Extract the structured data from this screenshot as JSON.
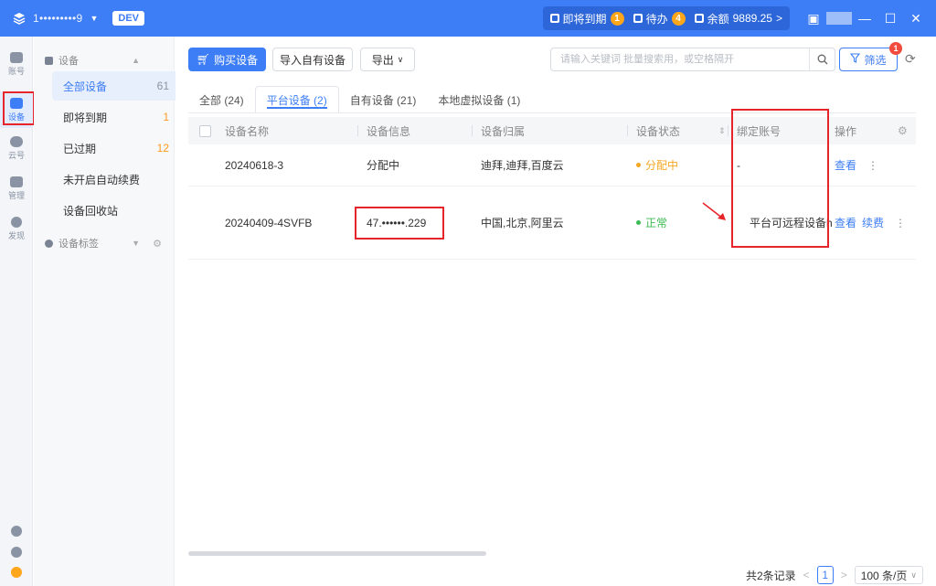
{
  "titlebar": {
    "account": "1•••••••••9",
    "env": "DEV",
    "expiring_label": "即将到期",
    "expiring_count": "1",
    "todo_label": "待办",
    "todo_count": "4",
    "balance_label": "余额",
    "balance_value": "9889.25",
    "balance_arrow": ">"
  },
  "rail": [
    {
      "label": "账号"
    },
    {
      "label": "设备"
    },
    {
      "label": "云号"
    },
    {
      "label": "管理"
    },
    {
      "label": "发现"
    }
  ],
  "sidebar": {
    "group_devices": "设备",
    "group_tags": "设备标签",
    "items": [
      {
        "label": "全部设备",
        "count": "61"
      },
      {
        "label": "即将到期",
        "count": "1"
      },
      {
        "label": "已过期",
        "count": "12"
      },
      {
        "label": "未开启自动续费",
        "count": ""
      },
      {
        "label": "设备回收站",
        "count": ""
      }
    ]
  },
  "toolbar": {
    "buy_label": "购买设备",
    "import_label": "导入自有设备",
    "export_label": "导出",
    "search_placeholder": "请输入关键词 批量搜索用，或空格隔开",
    "filter_label": "筛选",
    "filter_badge": "1"
  },
  "tabs": [
    {
      "label": "全部 (24)"
    },
    {
      "label": "平台设备 (2)"
    },
    {
      "label": "自有设备 (21)"
    },
    {
      "label": "本地虚拟设备 (1)"
    }
  ],
  "table": {
    "headers": [
      "设备名称",
      "设备信息",
      "设备归属",
      "设备状态",
      "绑定账号",
      "操作"
    ],
    "rows": [
      {
        "name": "20240618-3",
        "info": "分配中",
        "owner": "迪拜,迪拜,百度云",
        "status": "分配中",
        "status_color": "#f5a623",
        "account": "-",
        "actions": [
          "查看"
        ]
      },
      {
        "name": "20240409-4SVFB",
        "info": "47.••••••.229",
        "owner": "中国,北京,阿里云",
        "status": "正常",
        "status_color": "#3cba54",
        "account": "平台可远程设备h",
        "actions": [
          "查看",
          "续费"
        ]
      }
    ]
  },
  "pager": {
    "total": "共2条记录",
    "prev": "<",
    "page": "1",
    "next": ">",
    "page_size": "100 条/页"
  },
  "colors": {
    "brand": "#3d7df5",
    "highlight": "#e8242b"
  }
}
